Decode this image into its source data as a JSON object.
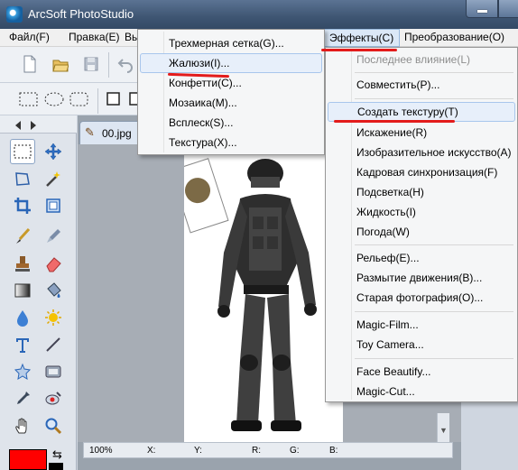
{
  "window": {
    "title": "ArcSoft PhotoStudio"
  },
  "menubar": {
    "items": [
      {
        "label": "Файл(F)"
      },
      {
        "label": "Правка(E)"
      },
      {
        "label": "Вы"
      },
      {
        "label": "Эффекты(C)"
      },
      {
        "label": "Преобразование(O)"
      }
    ]
  },
  "texture_submenu": {
    "items": [
      {
        "label": "Трехмерная сетка(G)..."
      },
      {
        "label": "Жалюзи(I)..."
      },
      {
        "label": "Конфетти(C)..."
      },
      {
        "label": "Мозаика(M)..."
      },
      {
        "label": "Всплеск(S)..."
      },
      {
        "label": "Текстура(X)..."
      }
    ]
  },
  "effects_menu": {
    "items": [
      {
        "label": "Последнее влияние(L)"
      },
      {
        "label": "Совместить(P)..."
      },
      {
        "label": "Создать текстуру(T)"
      },
      {
        "label": "Искажение(R)"
      },
      {
        "label": "Изобразительное искусство(A)"
      },
      {
        "label": "Кадровая синхронизация(F)"
      },
      {
        "label": "Подсветка(H)"
      },
      {
        "label": "Жидкость(I)"
      },
      {
        "label": "Погода(W)"
      },
      {
        "label": "Рельеф(E)..."
      },
      {
        "label": "Размытие движения(B)..."
      },
      {
        "label": "Старая фотография(O)..."
      },
      {
        "label": "Magic-Film..."
      },
      {
        "label": "Toy Camera..."
      },
      {
        "label": "Face Beautify..."
      },
      {
        "label": "Magic-Cut..."
      }
    ]
  },
  "document": {
    "tab_label": "00.jpg"
  },
  "statusbar": {
    "zoom": "100%",
    "x_label": "X:",
    "y_label": "Y:",
    "r_label": "R:",
    "g_label": "G:",
    "b_label": "B:"
  },
  "colors": {
    "foreground": "#ff0000",
    "background": "#000000",
    "annotation": "#e31b1b",
    "menu_highlight": "#e7effa"
  },
  "icons": [
    "rect-select-icon",
    "move-icon",
    "lasso-icon",
    "magic-wand-icon",
    "crop-icon",
    "transform-icon",
    "brush-icon",
    "eyedropper-icon",
    "stamp-icon",
    "eraser-icon",
    "gradient-icon",
    "bucket-icon",
    "blur-drop-icon",
    "sun-icon",
    "text-icon",
    "line-icon",
    "shape-icon",
    "rect-shape-icon",
    "pipette-icon",
    "red-eye-icon",
    "hand-icon",
    "zoom-icon"
  ]
}
